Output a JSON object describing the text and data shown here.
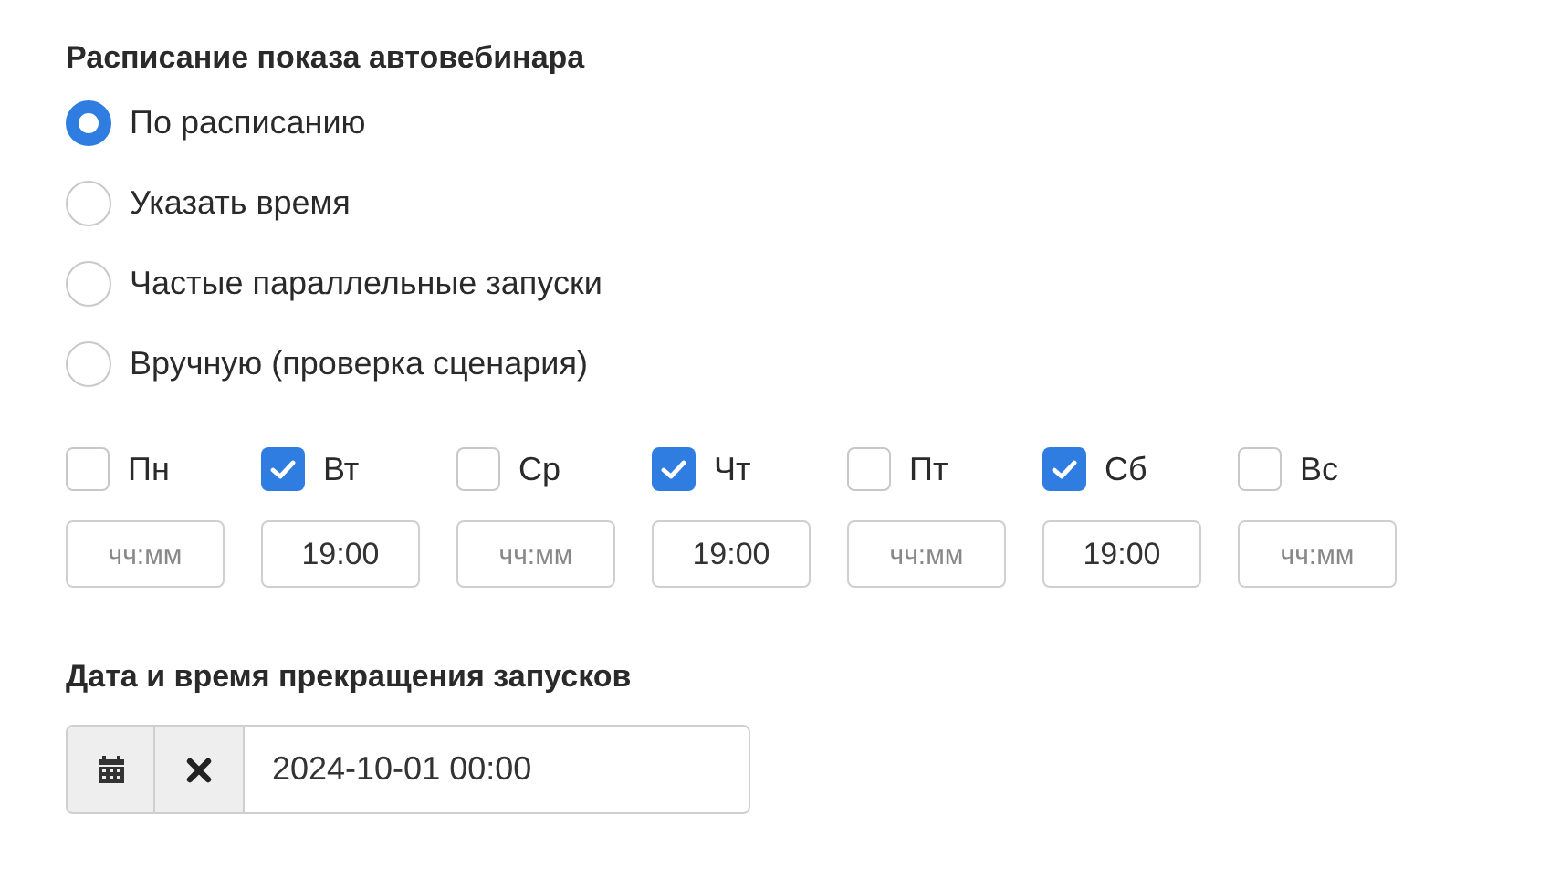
{
  "schedule": {
    "title": "Расписание показа автовебинара",
    "options": [
      {
        "label": "По расписанию",
        "selected": true
      },
      {
        "label": "Указать время",
        "selected": false
      },
      {
        "label": "Частые параллельные запуски",
        "selected": false
      },
      {
        "label": "Вручную (проверка сценария)",
        "selected": false
      }
    ],
    "days": [
      {
        "label": "Пн",
        "checked": false,
        "time": {
          "placeholder": "чч:мм"
        }
      },
      {
        "label": "Вт",
        "checked": true,
        "time": {
          "value": "19:00"
        }
      },
      {
        "label": "Ср",
        "checked": false,
        "time": {
          "placeholder": "чч:мм"
        }
      },
      {
        "label": "Чт",
        "checked": true,
        "time": {
          "value": "19:00"
        }
      },
      {
        "label": "Пт",
        "checked": false,
        "time": {
          "placeholder": "чч:мм"
        }
      },
      {
        "label": "Сб",
        "checked": true,
        "time": {
          "value": "19:00"
        }
      },
      {
        "label": "Вс",
        "checked": false,
        "time": {
          "placeholder": "чч:мм"
        }
      }
    ]
  },
  "stop": {
    "title": "Дата и время прекращения запусков",
    "value": "2024-10-01 00:00"
  }
}
